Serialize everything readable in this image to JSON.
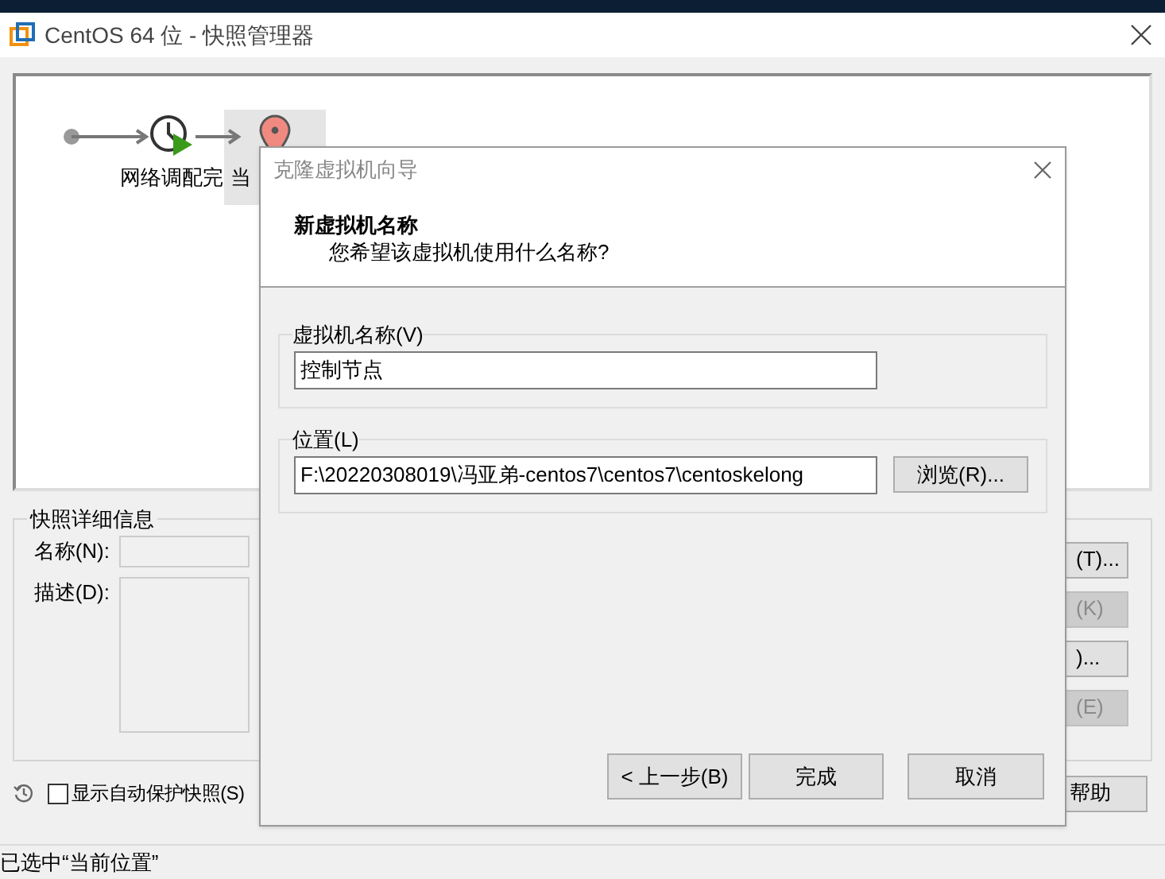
{
  "window": {
    "title": "CentOS 64 位 - 快照管理器"
  },
  "snapshot_tree": {
    "nodes": [
      {
        "kind": "snapshot",
        "label": "网络调配完",
        "selected": false
      },
      {
        "kind": "current",
        "label": "当",
        "selected": true
      }
    ]
  },
  "details": {
    "title": "快照详细信息",
    "name_label": "名称(N):",
    "description_label": "描述(D):"
  },
  "side_buttons": [
    {
      "label": "(T)...",
      "disabled": false
    },
    {
      "label": "(K)",
      "disabled": true
    },
    {
      "label": ")...",
      "disabled": false
    },
    {
      "label": "(E)",
      "disabled": true
    }
  ],
  "autosave": {
    "label": "显示自动保护快照(S)",
    "checked": false
  },
  "help_button": "帮助",
  "status_bar": "已选中“当前位置”",
  "dialog": {
    "title": "克隆虚拟机向导",
    "heading": "新虚拟机名称",
    "subheading": "您希望该虚拟机使用什么名称?",
    "name_group": {
      "label": "虚拟机名称(V)",
      "value": "控制节点"
    },
    "location_group": {
      "label": "位置(L)",
      "value": "F:\\20220308019\\冯亚弟-centos7\\centos7\\centoskelong",
      "browse": "浏览(R)..."
    },
    "buttons": [
      {
        "kind": "back",
        "label": "< 上一步(B)"
      },
      {
        "kind": "finish",
        "label": "完成"
      },
      {
        "kind": "cancel",
        "label": "取消"
      }
    ]
  }
}
